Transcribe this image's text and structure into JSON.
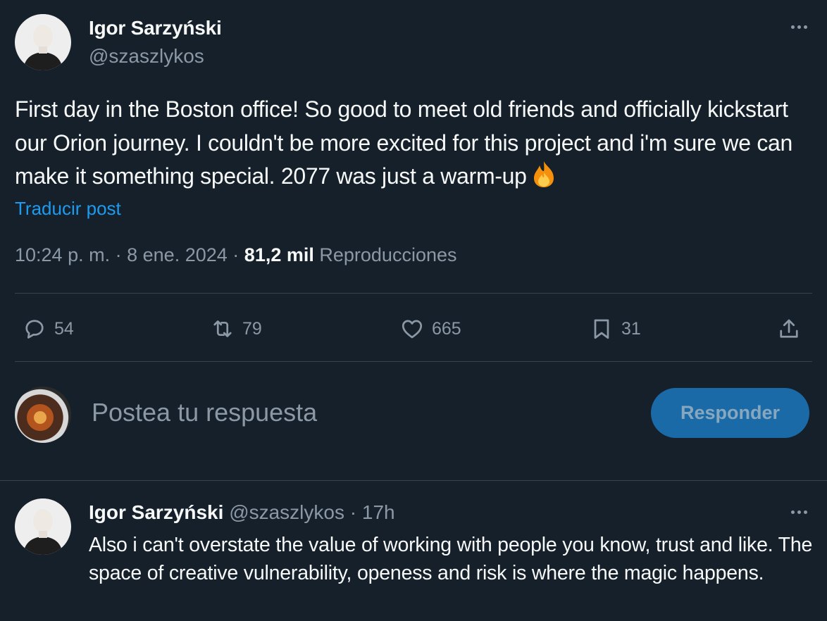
{
  "main_tweet": {
    "author_name": "Igor Sarzyński",
    "author_handle": "@szaszlykos",
    "text": "First day in the Boston office! So good to meet old friends and officially kickstart our Orion journey. I couldn't be more excited for this project and i'm sure we can make it something special. 2077 was just a warm-up",
    "emoji_icon": "fire-emoji",
    "translate_label": "Traducir post",
    "time": "10:24 p. m.",
    "separator": "·",
    "date": "8 ene. 2024",
    "views_count": "81,2 mil",
    "views_label": "Reproducciones",
    "actions": {
      "replies": "54",
      "reposts": "79",
      "likes": "665",
      "bookmarks": "31"
    }
  },
  "composer": {
    "placeholder": "Postea tu respuesta",
    "button_label": "Responder"
  },
  "reply_tweet": {
    "author_name": "Igor Sarzyński",
    "author_handle": "@szaszlykos",
    "separator": "·",
    "time_ago": "17h",
    "text": "Also i can't overstate the value of working with people you know, trust and like. The space of creative vulnerability, openess and risk is where the magic happens."
  },
  "colors": {
    "background": "#15202b",
    "text_primary": "#f7f9f9",
    "text_secondary": "#8b98a5",
    "link": "#1d9bf0",
    "divider": "#38444d",
    "button_disabled": "#1a6aa8"
  }
}
